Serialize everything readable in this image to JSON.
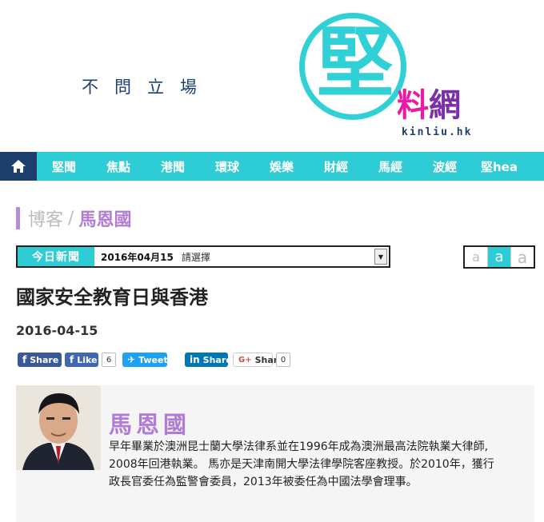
{
  "header": {
    "slogan": "不問立場",
    "logo_glyph": "堅",
    "logo_sub_1": "料",
    "logo_sub_2": "網",
    "logo_url": "kinliu.hk"
  },
  "nav": {
    "home_icon": "home-icon",
    "items": [
      "堅聞",
      "焦點",
      "港聞",
      "環球",
      "娛樂",
      "財經",
      "馬經",
      "波經",
      "堅hea"
    ]
  },
  "breadcrumb": {
    "root": "博客",
    "separator": "/",
    "current": "馬恩國"
  },
  "date_selector": {
    "label": "今日新聞",
    "value": "2016年04月15",
    "placeholder": "請選擇"
  },
  "font_size": {
    "options": [
      "a",
      "a",
      "a"
    ],
    "active_index": 1
  },
  "article": {
    "title": "國家安全教育日與香港",
    "date": "2016-04-15"
  },
  "share": {
    "fb_share": "Share",
    "fb_like": "Like",
    "fb_like_count": "6",
    "tweet": "Tweet",
    "linkedin": "Share",
    "gplus": "Share",
    "gplus_count": "0"
  },
  "author": {
    "name": "馬恩國",
    "bio": "早年畢業於澳洲昆士蘭大學法律系並在1996年成為澳洲最高法院執業大律師, 2008年回港執業。 馬亦是天津南開大學法律學院客座教授。於2010年，獲行政長官委任為監警會委員，2013年被委任為中國法學會理事。"
  },
  "colors": {
    "accent": "#2ecdd6",
    "navy": "#1d3f6e",
    "purple": "#b07cd4",
    "magenta": "#e81ba7"
  }
}
